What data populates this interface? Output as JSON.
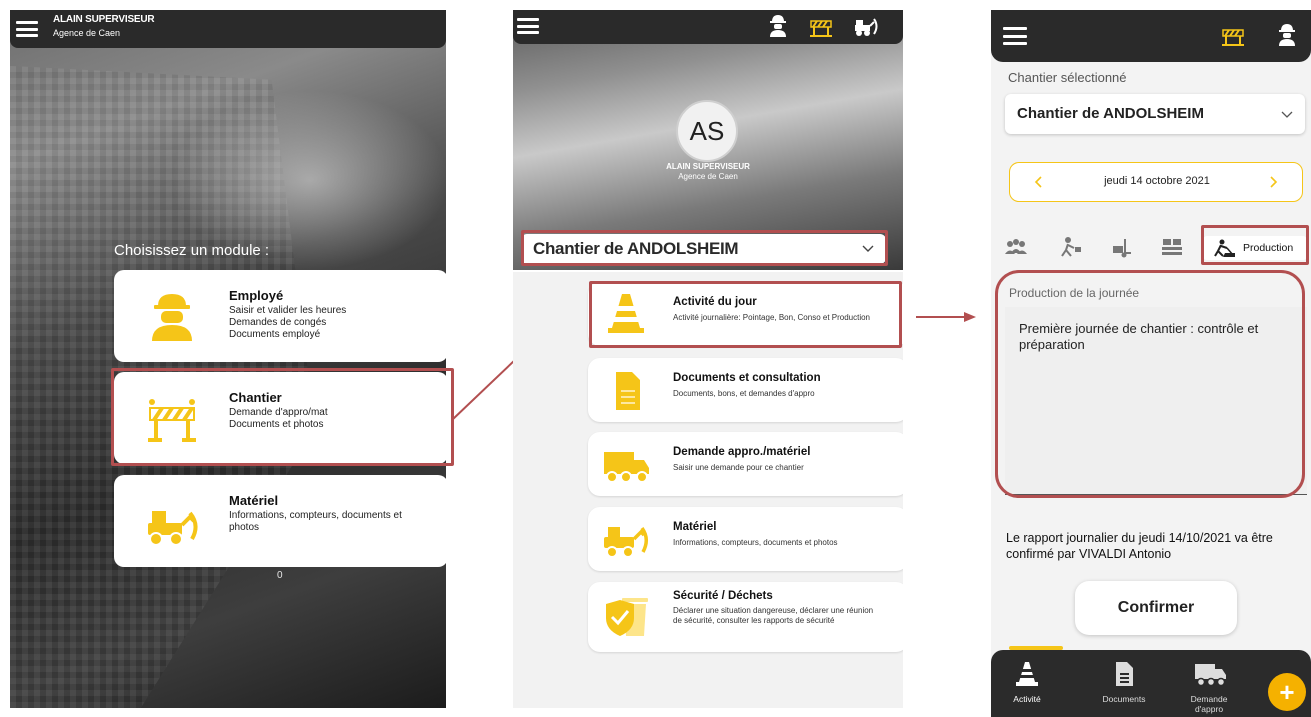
{
  "colors": {
    "accent_yellow": "#f5c518",
    "highlight_red": "#b24f50",
    "topbar": "#2a2a2a",
    "fab": "#f5b100"
  },
  "screen1": {
    "user_name": "ALAIN SUPERVISEUR",
    "agency": "Agence de Caen",
    "choose_label": "Choisissez un module :",
    "modules": [
      {
        "title": "Employé",
        "desc": [
          "Saisir et valider les heures",
          "Demandes de congés",
          "Documents employé"
        ],
        "icon": "worker-icon"
      },
      {
        "title": "Chantier",
        "desc": [
          "Demande d'appro/mat",
          "Documents et photos"
        ],
        "icon": "barrier-icon"
      },
      {
        "title": "Matériel",
        "desc": [
          "Informations, compteurs, documents et photos"
        ],
        "icon": "loader-icon"
      }
    ],
    "counter": "0"
  },
  "screen2": {
    "avatar_initials": "AS",
    "user_name": "ALAIN SUPERVISEUR",
    "agency": "Agence de Caen",
    "site_selected": "Chantier de ANDOLSHEIM",
    "actions": [
      {
        "title": "Activité du jour",
        "desc": "Activité journalière: Pointage, Bon, Conso et Production",
        "icon": "cone-icon"
      },
      {
        "title": "Documents et consultation",
        "desc": "Documents, bons, et demandes d'appro",
        "icon": "document-icon"
      },
      {
        "title": "Demande appro./matériel",
        "desc": "Saisir une demande pour ce chantier",
        "icon": "truck-icon"
      },
      {
        "title": "Matériel",
        "desc": "Informations, compteurs, documents et photos",
        "icon": "loader-icon"
      },
      {
        "title": "Sécurité / Déchets",
        "desc": "Déclarer une situation dangereuse, déclarer une réunion de sécurité, consulter les rapports de sécurité",
        "icon": "safety-bin-icon"
      }
    ]
  },
  "screen3": {
    "selected_label": "Chantier sélectionné",
    "site_selected": "Chantier de ANDOLSHEIM",
    "date": "jeudi 14 octobre 2021",
    "tab_production": "Production",
    "production_label": "Production de la journée",
    "production_text": "Première journée de chantier : contrôle et préparation",
    "report_text": "Le rapport journalier du jeudi 14/10/2021 va être confirmé par VIVALDI Antonio",
    "confirm_label": "Confirmer",
    "nav": [
      {
        "label": "Activité",
        "icon": "cone-icon"
      },
      {
        "label": "Documents",
        "icon": "document-icon"
      },
      {
        "label": "Demande d'appro",
        "icon": "truck-icon"
      }
    ],
    "fab_label": "+"
  }
}
